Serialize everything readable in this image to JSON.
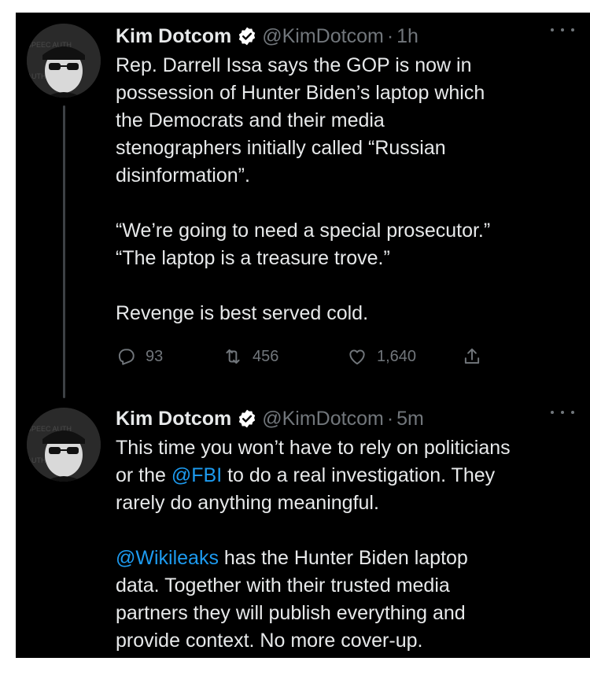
{
  "tweets": [
    {
      "author": {
        "name": "Kim Dotcom",
        "handle": "@KimDotcom"
      },
      "separator": "·",
      "time": "1h",
      "paragraphs": [
        "Rep. Darrell Issa says the GOP is now in\npossession of Hunter Biden’s laptop which\nthe Democrats and their media\nstenographers initially called “Russian\ndisinformation”.",
        "“We’re going to need a special prosecutor.”\n“The laptop is a treasure trove.”",
        "Revenge is best served cold."
      ],
      "stats": {
        "replies": "93",
        "retweets": "456",
        "likes": "1,640"
      }
    },
    {
      "author": {
        "name": "Kim Dotcom",
        "handle": "@KimDotcom"
      },
      "separator": "·",
      "time": "5m",
      "p1_a": "This time you won’t have to rely on politicians\nor the ",
      "p1_mention": "@FBI",
      "p1_b": " to do a real investigation. They\nrarely do anything meaningful.",
      "p2_mention": "@Wikileaks",
      "p2_b": " has the Hunter Biden laptop\ndata. Together with their trusted media\npartners they will publish everything and\nprovide context. No more cover-up."
    }
  ],
  "colors": {
    "background": "#000000",
    "text": "#e7e9ea",
    "secondary": "#71767b",
    "link": "#1d9bf0",
    "verified": "#ffffff"
  },
  "icons": [
    "verified-badge-icon",
    "more-icon",
    "reply-icon",
    "retweet-icon",
    "like-icon",
    "share-icon",
    "avatar"
  ]
}
